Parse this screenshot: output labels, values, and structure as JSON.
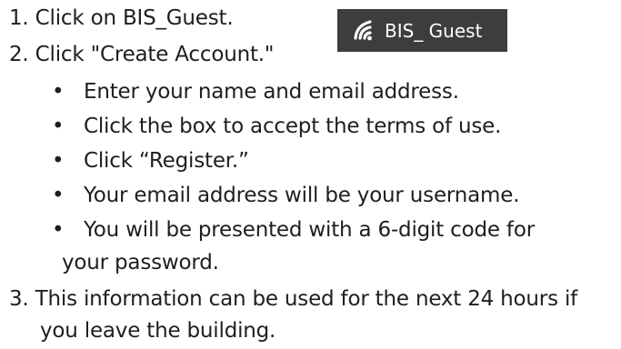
{
  "steps": [
    {
      "number": "1.",
      "text": "Click on BIS_Guest."
    },
    {
      "number": "2.",
      "text": "Click \"Create Account.\""
    },
    {
      "number": "3.",
      "text": "This information can be used for the next 24 hours if",
      "continuation": "you leave the building."
    }
  ],
  "bullets": [
    {
      "text": "Enter your name and email address."
    },
    {
      "text": "Click the box to accept the terms of use."
    },
    {
      "text": "Click “Register.”"
    },
    {
      "text": "Your email address will be your username."
    },
    {
      "text": "You will be presented with a 6-digit code for",
      "continuation": "your password."
    }
  ],
  "bullet_glyph": "•",
  "wifi_badge": {
    "label": "BIS_ Guest",
    "icon": "wifi-icon",
    "background": "#3d3d3d",
    "foreground": "#ffffff"
  }
}
